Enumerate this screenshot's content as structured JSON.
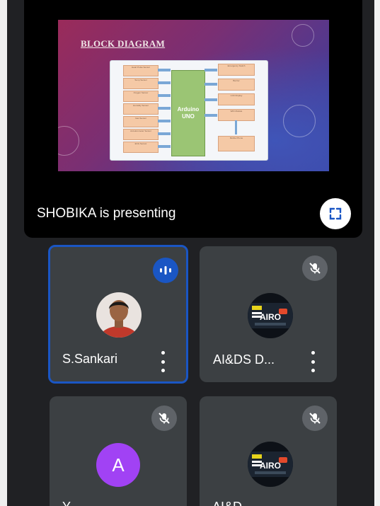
{
  "presentation": {
    "slide_title": "BLOCK DIAGRAM",
    "center_block": [
      "Arduino",
      "UNO"
    ],
    "left_blocks": [
      "Heart Pulse Sensor",
      "Temp Sensor",
      "Oxygen Sensor",
      "Humidity Sensor",
      "Gas Sensor",
      "Accelerometer Sensor",
      "ECG Sensor"
    ],
    "right_blocks": [
      "Emergency Switch",
      "Buzzer",
      "LCD Display",
      "WiFi Module",
      "Mobile Phone"
    ],
    "presenter_label": "SHOBIKA is presenting",
    "fullscreen_icon": "fullscreen-icon"
  },
  "participants": [
    {
      "name": "S.Sankari",
      "mic": "speaking",
      "avatar": "photo"
    },
    {
      "name": "AI&DS D...",
      "mic": "muted",
      "avatar": "AIRO logo",
      "logo_text": "AIRO"
    },
    {
      "name": "Y...",
      "mic": "muted",
      "avatar": "letter",
      "letter": "A"
    },
    {
      "name": "AI&D...",
      "mic": "muted",
      "avatar": "AIRO logo",
      "logo_text": "AIRO"
    }
  ],
  "colors": {
    "background": "#202124",
    "tile": "#3c4043",
    "active_border": "#1a56c4",
    "letter_avatar": "#a142f4"
  }
}
